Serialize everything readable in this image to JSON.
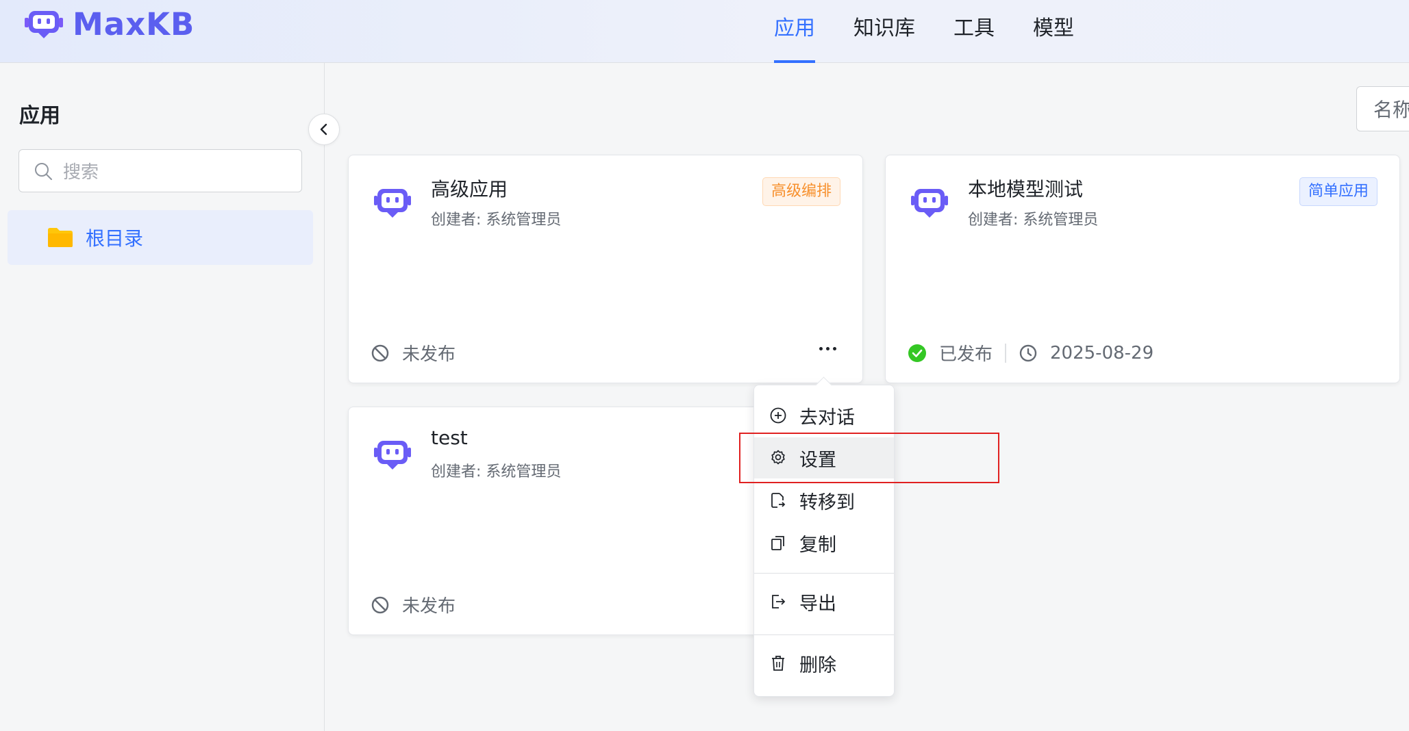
{
  "header": {
    "logo_text": "MaxKB",
    "nav": [
      "应用",
      "知识库",
      "工具",
      "模型"
    ],
    "active_nav": "应用"
  },
  "sidebar": {
    "title": "应用",
    "search_placeholder": "搜索",
    "tree": [
      {
        "label": "根目录",
        "icon": "folder-icon",
        "selected": true
      }
    ]
  },
  "toolbar": {
    "sort_label": "名称"
  },
  "apps": [
    {
      "title": "高级应用",
      "creator": "创建者: 系统管理员",
      "tag": "高级编排",
      "status": "未发布",
      "published": false
    },
    {
      "title": "本地模型测试",
      "creator": "创建者: 系统管理员",
      "tag": "简单应用",
      "status": "已发布",
      "published": true,
      "date": "2025-08-29"
    },
    {
      "title": "test",
      "creator": "创建者: 系统管理员",
      "tag": "",
      "status": "未发布",
      "published": false
    }
  ],
  "context_menu": {
    "items": [
      {
        "label": "去对话",
        "icon": "chat-plus-icon"
      },
      {
        "label": "设置",
        "icon": "gear-icon",
        "highlighted": true
      },
      {
        "label": "转移到",
        "icon": "move-file-icon"
      },
      {
        "label": "复制",
        "icon": "copy-icon"
      },
      {
        "label": "导出",
        "icon": "export-icon"
      },
      {
        "label": "删除",
        "icon": "trash-icon"
      }
    ]
  },
  "colors": {
    "primary": "#3370ff",
    "logo": "#5b5fef",
    "published": "#34c724",
    "highlight_box": "#e02020",
    "tag_orange": "#f7902d"
  }
}
